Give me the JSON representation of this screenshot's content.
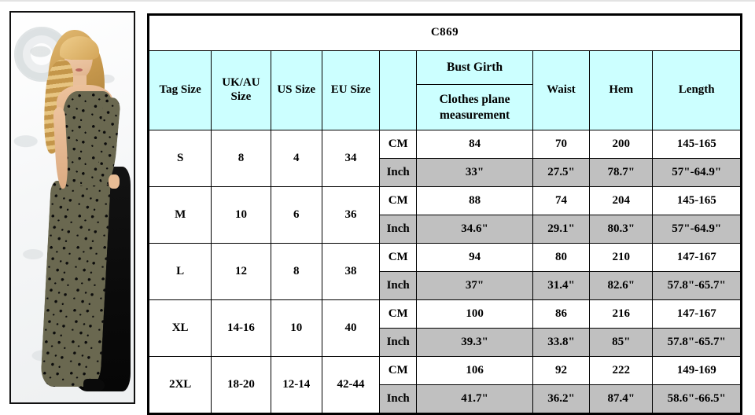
{
  "product": {
    "title": "C869",
    "photo_alt": "one-shoulder black and olive lace evening gown"
  },
  "table": {
    "headers": {
      "tag_size": "Tag Size",
      "uk_au_size": "UK/AU Size",
      "us_size": "US Size",
      "eu_size": "EU Size",
      "unit": "",
      "bust_girth": "Bust Girth",
      "bust_note": "Clothes plane measurement",
      "waist": "Waist",
      "hem": "Hem",
      "length": "Length"
    },
    "unit_labels": {
      "cm": "CM",
      "inch": "Inch"
    },
    "rows": [
      {
        "tag_size": "S",
        "uk_au": "8",
        "us": "4",
        "eu": "34",
        "cm": {
          "bust": "84",
          "waist": "70",
          "hem": "200",
          "length": "145-165"
        },
        "inch": {
          "bust": "33\"",
          "waist": "27.5\"",
          "hem": "78.7\"",
          "length": "57\"-64.9\""
        }
      },
      {
        "tag_size": "M",
        "uk_au": "10",
        "us": "6",
        "eu": "36",
        "cm": {
          "bust": "88",
          "waist": "74",
          "hem": "204",
          "length": "145-165"
        },
        "inch": {
          "bust": "34.6\"",
          "waist": "29.1\"",
          "hem": "80.3\"",
          "length": "57\"-64.9\""
        }
      },
      {
        "tag_size": "L",
        "uk_au": "12",
        "us": "8",
        "eu": "38",
        "cm": {
          "bust": "94",
          "waist": "80",
          "hem": "210",
          "length": "147-167"
        },
        "inch": {
          "bust": "37\"",
          "waist": "31.4\"",
          "hem": "82.6\"",
          "length": "57.8\"-65.7\""
        }
      },
      {
        "tag_size": "XL",
        "uk_au": "14-16",
        "us": "10",
        "eu": "40",
        "cm": {
          "bust": "100",
          "waist": "86",
          "hem": "216",
          "length": "147-167"
        },
        "inch": {
          "bust": "39.3\"",
          "waist": "33.8\"",
          "hem": "85\"",
          "length": "57.8\"-65.7\""
        }
      },
      {
        "tag_size": "2XL",
        "uk_au": "18-20",
        "us": "12-14",
        "eu": "42-44",
        "cm": {
          "bust": "106",
          "waist": "92",
          "hem": "222",
          "length": "149-169"
        },
        "inch": {
          "bust": "41.7\"",
          "waist": "36.2\"",
          "hem": "87.4\"",
          "length": "58.6\"-66.5\""
        }
      }
    ]
  },
  "colors": {
    "header_bg": "#ccffff",
    "inch_row_bg": "#c0c0c0",
    "border": "#000000",
    "page_bg": "#ffffff"
  }
}
